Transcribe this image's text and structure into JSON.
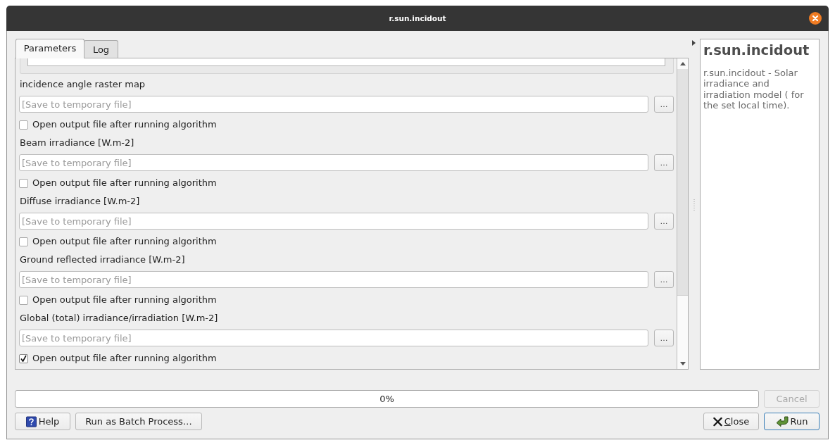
{
  "window": {
    "title": "r.sun.incidout"
  },
  "tabs": [
    {
      "label": "Parameters",
      "selected": true
    },
    {
      "label": "Log",
      "selected": false
    }
  ],
  "parameters": [
    {
      "label": "incidence angle raster map",
      "placeholder": "[Save to temporary file]",
      "browse": "…",
      "open_output": {
        "label": "Open output file after running algorithm",
        "checked": false
      }
    },
    {
      "label": "Beam irradiance [W.m-2]",
      "placeholder": "[Save to temporary file]",
      "browse": "…",
      "open_output": {
        "label": "Open output file after running algorithm",
        "checked": false
      }
    },
    {
      "label": "Diffuse irradiance [W.m-2]",
      "placeholder": "[Save to temporary file]",
      "browse": "…",
      "open_output": {
        "label": "Open output file after running algorithm",
        "checked": false
      }
    },
    {
      "label": "Ground reflected irradiance [W.m-2]",
      "placeholder": "[Save to temporary file]",
      "browse": "…",
      "open_output": {
        "label": "Open output file after running algorithm",
        "checked": false
      }
    },
    {
      "label": "Global (total) irradiance/irradiation [W.m-2]",
      "placeholder": "[Save to temporary file]",
      "browse": "…",
      "open_output": {
        "label": "Open output file after running algorithm",
        "checked": true
      }
    }
  ],
  "help": {
    "title": "r.sun.incidout",
    "description": "r.sun.incidout - Solar irradiance and irradiation model ( for the set local time)."
  },
  "progress": {
    "level": 0,
    "reading": "0%"
  },
  "cancel_button": {
    "label": "Cancel",
    "disabled": true
  },
  "buttons": [
    {
      "label": "Help",
      "kind": "help",
      "default": false,
      "mnemonic": false
    },
    {
      "label": "Run as Batch Process…",
      "kind": "batch",
      "default": false,
      "mnemonic": false
    },
    {
      "label": "Close",
      "kind": "close",
      "default": false,
      "mnemonic": true
    },
    {
      "label": "Run",
      "kind": "run",
      "default": true,
      "mnemonic": false
    }
  ]
}
